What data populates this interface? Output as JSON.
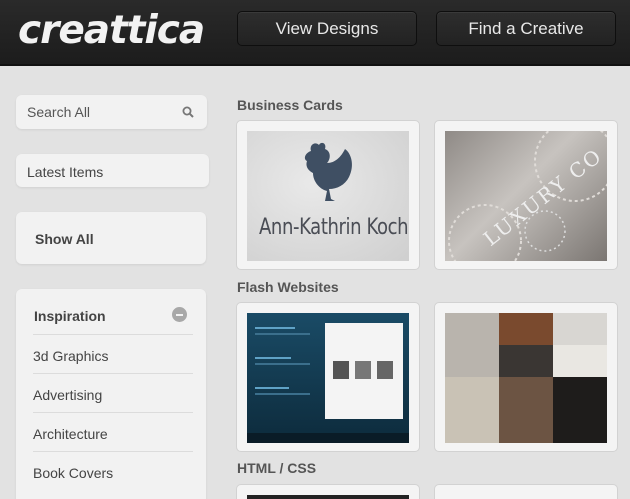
{
  "header": {
    "logo": "creattica",
    "nav": [
      {
        "label": "View Designs"
      },
      {
        "label": "Find a Creative"
      }
    ]
  },
  "sidebar": {
    "search_placeholder": "Search All",
    "latest": "Latest Items",
    "show_all": "Show All",
    "inspiration": {
      "title": "Inspiration",
      "items": [
        "3d Graphics",
        "Advertising",
        "Architecture",
        "Book Covers"
      ]
    }
  },
  "main": {
    "sections": [
      {
        "title": "Business Cards"
      },
      {
        "title": "Flash Websites"
      },
      {
        "title": "HTML / CSS"
      }
    ],
    "thumb_text": {
      "card_name": "Ann-Kathrin Koch",
      "luxury": "LUXURY CO"
    }
  },
  "colors": {
    "header_bg": "#1c1c1c",
    "page_bg": "#e2e2e2",
    "panel_bg": "#f2f2f2"
  }
}
